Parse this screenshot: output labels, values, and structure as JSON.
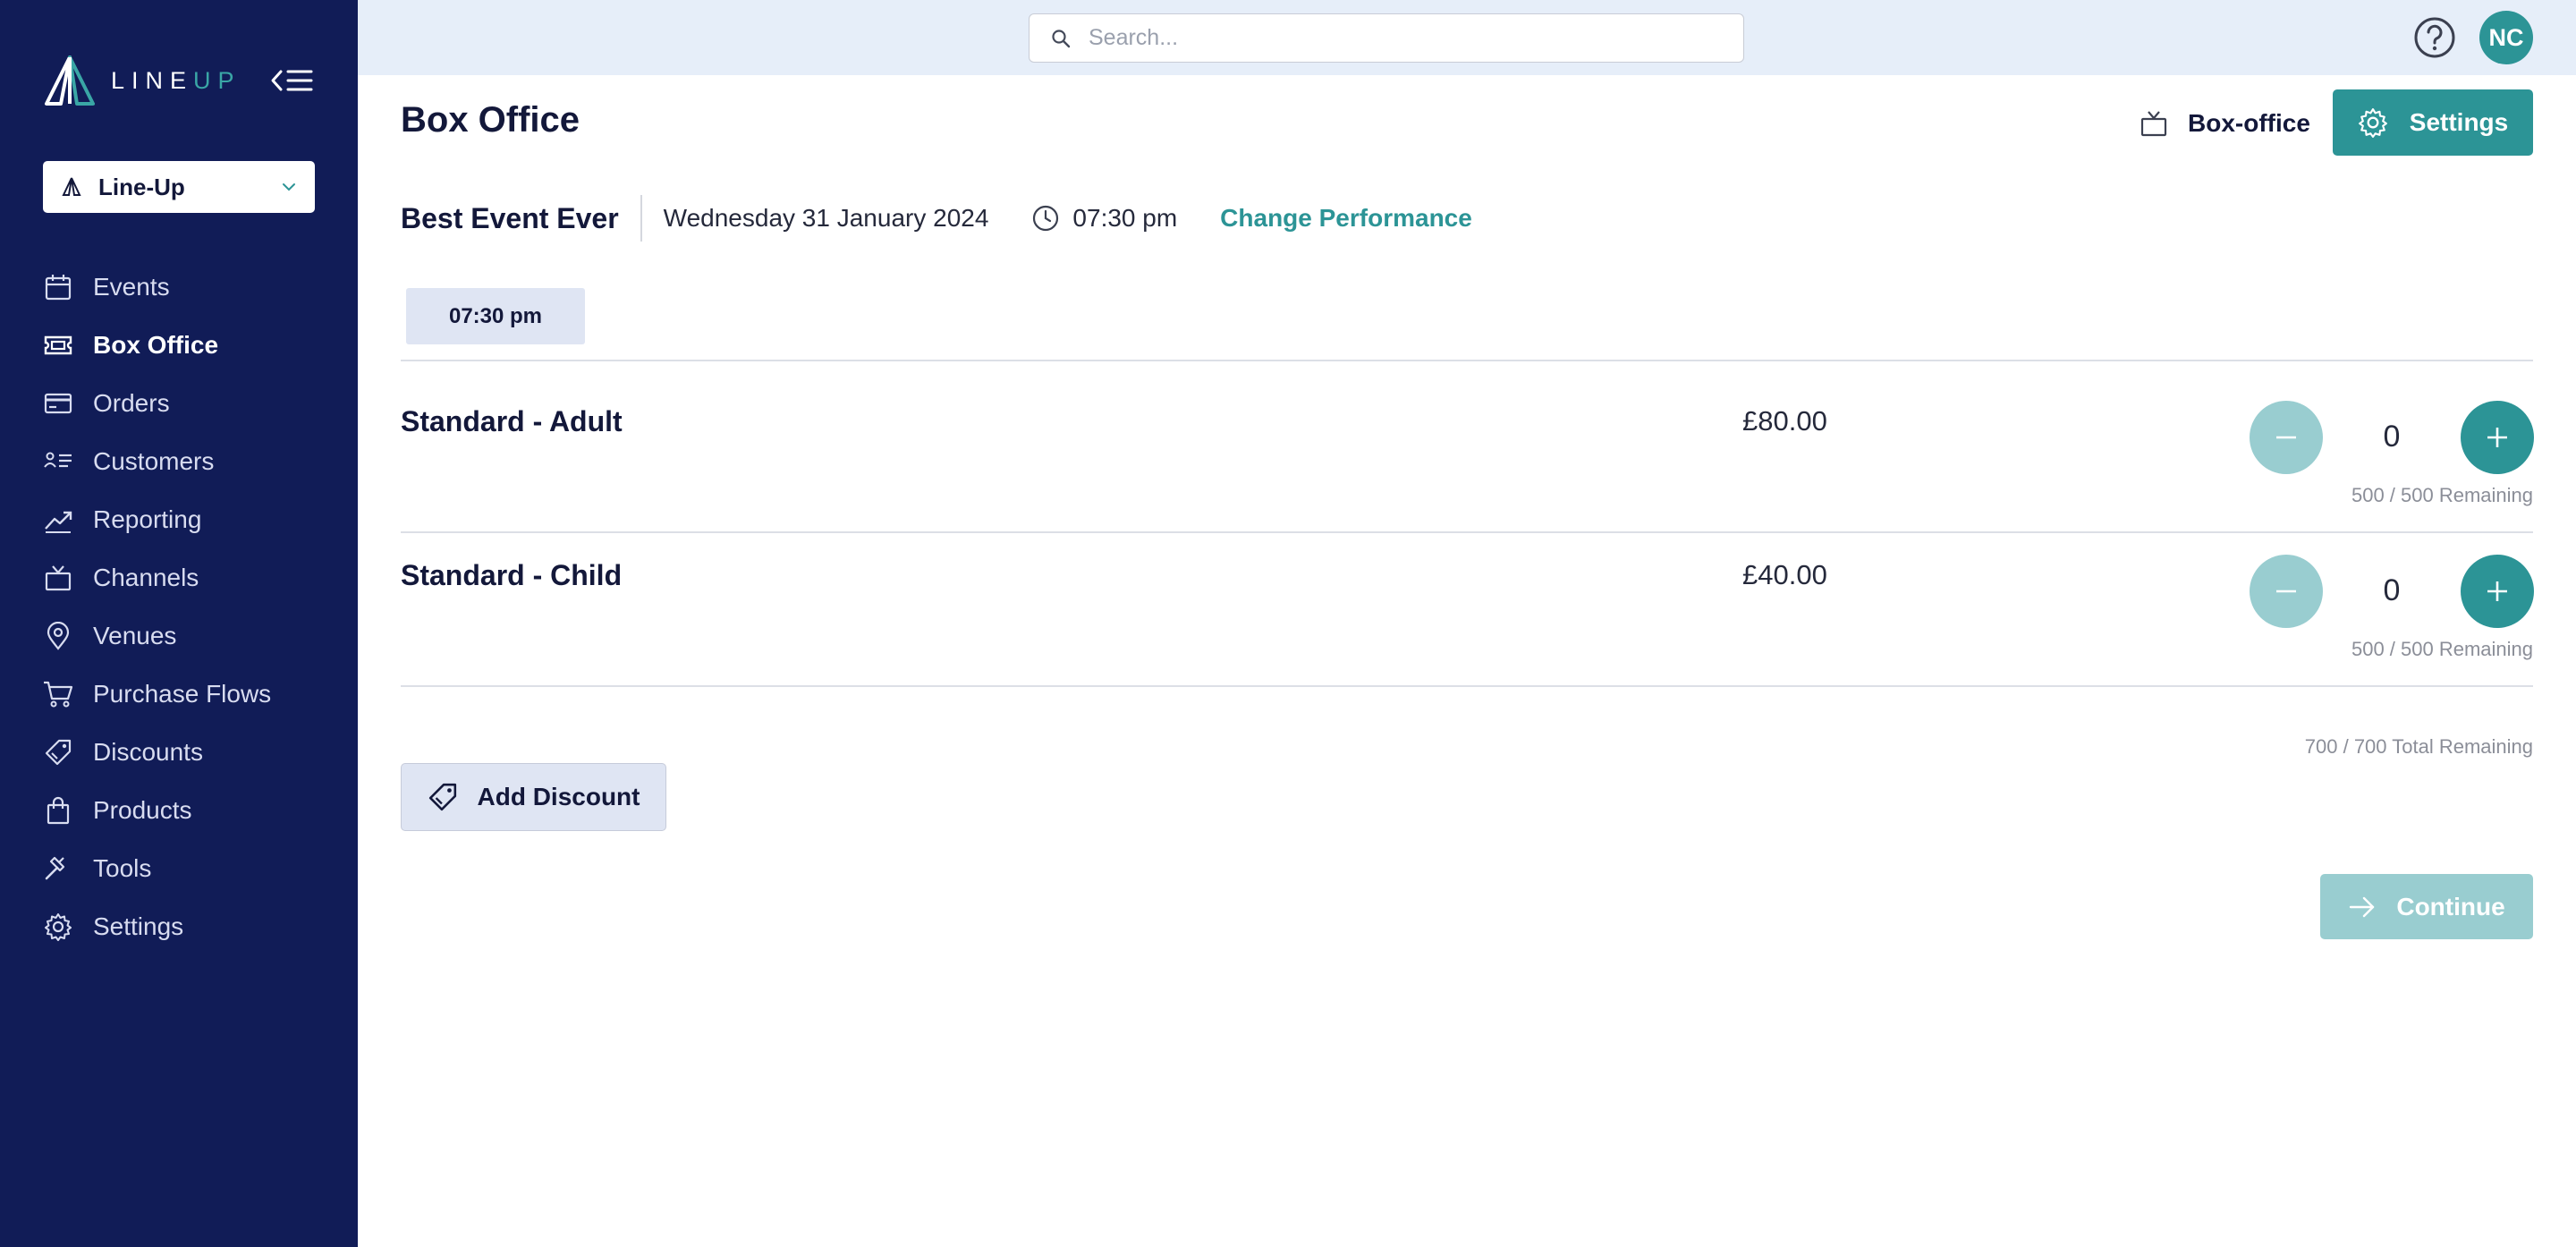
{
  "sidebar": {
    "logo": {
      "text_main": "LINE",
      "text_accent": "UP"
    },
    "org_select": {
      "value": "Line-Up"
    },
    "items": [
      {
        "label": "Events",
        "icon": "calendar-icon"
      },
      {
        "label": "Box Office",
        "icon": "ticket-icon",
        "active": true
      },
      {
        "label": "Orders",
        "icon": "card-icon"
      },
      {
        "label": "Customers",
        "icon": "customers-icon"
      },
      {
        "label": "Reporting",
        "icon": "chart-line-icon"
      },
      {
        "label": "Channels",
        "icon": "tv-icon"
      },
      {
        "label": "Venues",
        "icon": "map-pin-icon"
      },
      {
        "label": "Purchase Flows",
        "icon": "cart-icon"
      },
      {
        "label": "Discounts",
        "icon": "tag-icon"
      },
      {
        "label": "Products",
        "icon": "bag-icon"
      },
      {
        "label": "Tools",
        "icon": "hammer-icon"
      },
      {
        "label": "Settings",
        "icon": "gear-icon"
      }
    ]
  },
  "topbar": {
    "search_placeholder": "Search...",
    "avatar_initials": "NC"
  },
  "page": {
    "title": "Box Office",
    "channel_label": "Box-office",
    "settings_label": "Settings"
  },
  "event": {
    "name": "Best Event Ever",
    "date": "Wednesday 31 January 2024",
    "time": "07:30 pm",
    "change_label": "Change Performance",
    "performance_tab": "07:30 pm"
  },
  "tickets": [
    {
      "name": "Standard - Adult",
      "price": "£80.00",
      "quantity": "0",
      "remaining": "500 / 500 Remaining"
    },
    {
      "name": "Standard - Child",
      "price": "£40.00",
      "quantity": "0",
      "remaining": "500 / 500 Remaining"
    }
  ],
  "total_remaining": "700 / 700 Total Remaining",
  "actions": {
    "add_discount": "Add Discount",
    "continue": "Continue"
  },
  "colors": {
    "sidebar_bg": "#111c57",
    "accent": "#2c9496",
    "accent_disabled": "#99cdd0",
    "topbar_bg": "#e6eef9"
  }
}
